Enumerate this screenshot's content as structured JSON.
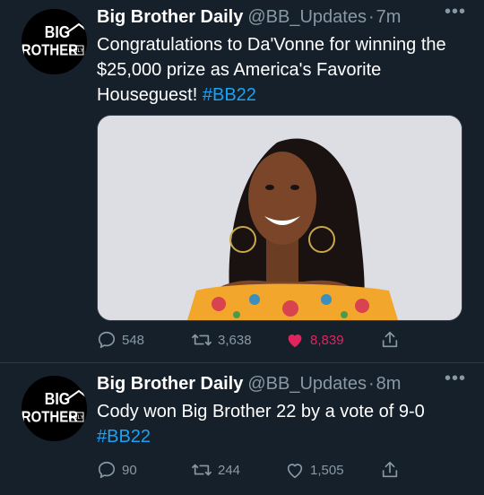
{
  "tweets": [
    {
      "author": {
        "name": "Big Brother Daily",
        "handle": "@BB_Updates",
        "separator": "·",
        "time": "7m",
        "avatar_text": {
          "line1": "BIG",
          "line2": "BROTHER",
          "tag": "DAILY"
        }
      },
      "text": {
        "body": "Congratulations to Da'Vonne for winning the $25,000 prize as America's Favorite Houseguest!",
        "hashtag": "#BB22"
      },
      "has_media": true,
      "actions": {
        "replies": "548",
        "retweets": "3,638",
        "likes": "8,839",
        "liked": true
      }
    },
    {
      "author": {
        "name": "Big Brother Daily",
        "handle": "@BB_Updates",
        "separator": "·",
        "time": "8m",
        "avatar_text": {
          "line1": "BIG",
          "line2": "BROTHER",
          "tag": "DAILY"
        }
      },
      "text": {
        "body": "Cody won Big Brother 22 by a vote of 9-0",
        "hashtag": "#BB22"
      },
      "has_media": false,
      "actions": {
        "replies": "90",
        "retweets": "244",
        "likes": "1,505",
        "liked": false
      }
    }
  ],
  "more_label": "•••",
  "icons": [
    "reply-icon",
    "retweet-icon",
    "like-icon",
    "share-icon",
    "more-icon"
  ],
  "colors": {
    "background": "#15202b",
    "text": "#ffffff",
    "muted": "#8899a6",
    "link": "#1da1f2",
    "like": "#e0245e"
  }
}
